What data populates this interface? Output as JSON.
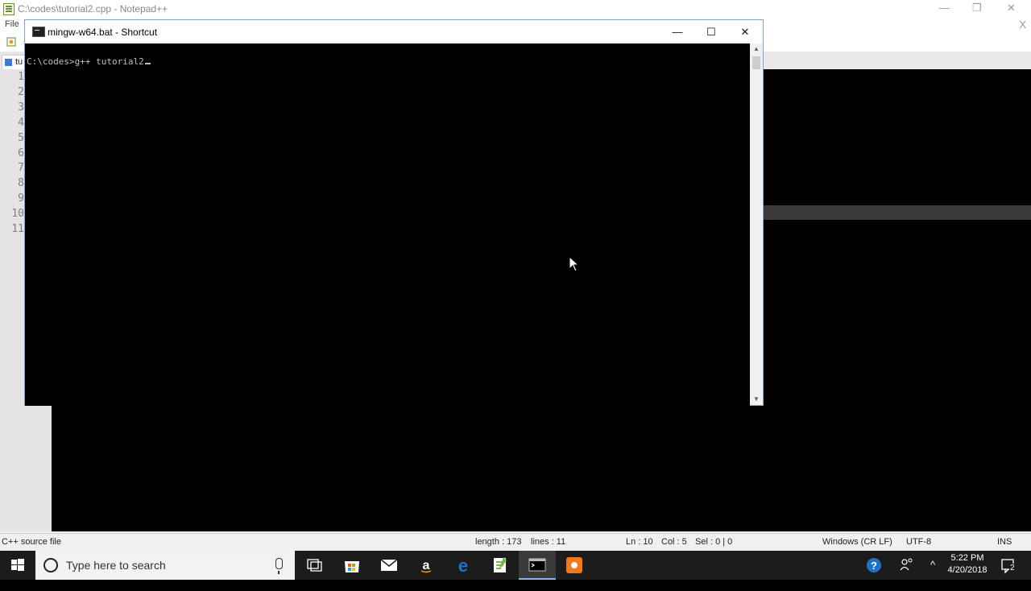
{
  "npp": {
    "title": "C:\\codes\\tutorial2.cpp - Notepad++",
    "menu_first": "File",
    "tab_label": "tu",
    "close_doc": "X",
    "controls": {
      "minimize": "—",
      "restore": "❐",
      "close": "✕"
    },
    "line_numbers": [
      "1",
      "2",
      "3",
      "4",
      "5",
      "6",
      "7",
      "8",
      "9",
      "10",
      "11"
    ],
    "status": {
      "file_type": "C++ source file",
      "length": "length : 173",
      "lines": "lines : 11",
      "ln": "Ln : 10",
      "col": "Col : 5",
      "sel": "Sel : 0 | 0",
      "eol": "Windows (CR LF)",
      "encoding": "UTF-8",
      "mode": "INS"
    }
  },
  "console": {
    "title": "mingw-w64.bat - Shortcut",
    "controls": {
      "minimize": "—",
      "maximize": "☐",
      "close": "✕"
    },
    "prompt": "C:\\codes>",
    "command": "g++ tutorial2"
  },
  "taskbar": {
    "search_placeholder": "Type here to search",
    "time": "5:22 PM",
    "date": "4/20/2018",
    "notification_count": "2",
    "tray_chevron": "^",
    "colors": {
      "accent": "#8ab4f8",
      "taskbar": "#1c1c1c",
      "edge": "#1e73c8",
      "npp": "#7ab648",
      "vlc": "#f07a1a"
    },
    "apps": [
      {
        "name": "task-view-icon"
      },
      {
        "name": "store-icon"
      },
      {
        "name": "mail-icon"
      },
      {
        "name": "amazon-icon"
      },
      {
        "name": "edge-icon"
      },
      {
        "name": "notepadpp-icon"
      },
      {
        "name": "cmd-icon"
      },
      {
        "name": "vlc-icon"
      }
    ]
  }
}
